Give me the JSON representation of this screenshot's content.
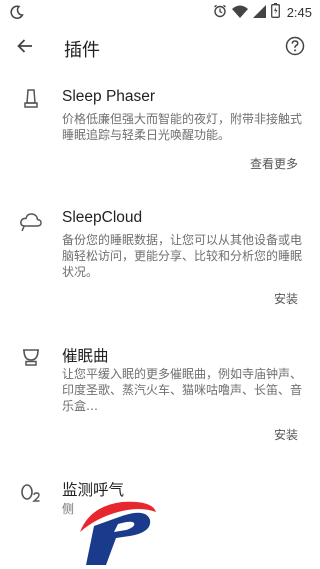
{
  "status_bar": {
    "time": "2:45",
    "icons": [
      "moon-icon",
      "alarm-icon",
      "wifi-icon",
      "signal-icon",
      "battery-icon"
    ]
  },
  "header": {
    "title": "插件",
    "back_icon": "arrow-back-icon",
    "help_icon": "help-circle-icon"
  },
  "plugins": [
    {
      "icon": "lamp-icon",
      "title": "Sleep Phaser",
      "description": "价格低廉但强大而智能的夜灯，附带非接触式睡眠追踪与轻柔日光唤醒功能。",
      "action": "查看更多"
    },
    {
      "icon": "cloud-icon",
      "title": "SleepCloud",
      "description": "备份您的睡眠数据，让您可以从其他设备或电脑轻松访问，更能分享、比较和分析您的睡眠状况。",
      "action": "安装"
    },
    {
      "icon": "bowl-icon",
      "title": "催眠曲",
      "description": "让您平缓入眠的更多催眠曲，例如寺庙钟声、印度圣歌、蒸汽火车、猫咪咕噜声、长笛、音乐盒…",
      "action": "安装"
    },
    {
      "icon": "o2-icon",
      "title": "监测呼气",
      "description": "侧"
    }
  ],
  "colors": {
    "watermark_red": "#e8262d",
    "watermark_blue": "#1a3a8c"
  }
}
